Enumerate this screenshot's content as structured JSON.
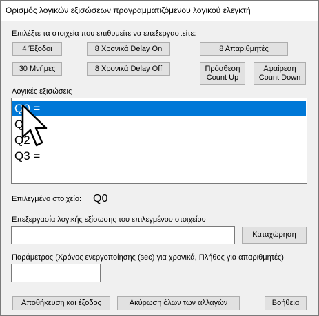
{
  "window": {
    "title": "Ορισμός λογικών εξισώσεων προγραμματιζόμενου λογικού ελεγκτή"
  },
  "selection": {
    "instruction": "Επιλέξτε τα στοιχεία που επιθυμείτε να επεξεργαστείτε:",
    "buttons": {
      "outputs": "4 Έξοδοι",
      "memories": "30 Μνήμες",
      "delay_on": "8 Χρονικά Delay On",
      "delay_off": "8 Χρονικά Delay Off",
      "counters": "8 Απαριθμητές",
      "add_count_up": "Πρόσθεση Count Up",
      "remove_count_down": "Αφαίρεση Count Down"
    }
  },
  "equations": {
    "label": "Λογικές εξισώσεις",
    "items": [
      {
        "text": "Q0 =",
        "selected": true
      },
      {
        "text": "Q1 =",
        "selected": false
      },
      {
        "text": "Q2 =",
        "selected": false
      },
      {
        "text": "Q3 =",
        "selected": false
      }
    ]
  },
  "selected_element": {
    "label": "Επιλεγμένο στοιχείο:",
    "value": "Q0"
  },
  "edit": {
    "label": "Επεξεργασία λογικής εξίσωσης του επιλεγμένου στοιχείου",
    "value": "",
    "submit_label": "Καταχώρηση"
  },
  "parameter": {
    "label": "Παράμετρος (Χρόνος ενεργοποίησης (sec) για χρονικά, Πλήθος για απαριθμητές)",
    "value": ""
  },
  "footer": {
    "save_exit": "Αποθήκευση και έξοδος",
    "cancel_all": "Ακύρωση όλων των αλλαγών",
    "help": "Βοήθεια"
  }
}
